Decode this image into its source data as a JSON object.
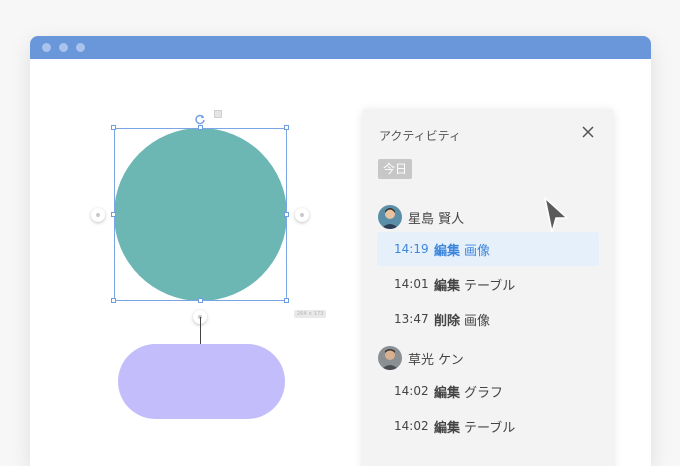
{
  "window": {
    "titlebar_color": "#6a97da"
  },
  "canvas": {
    "size_label": "264 × 173",
    "shapes": [
      {
        "kind": "circle",
        "color": "#6cb6b4",
        "selected": true
      },
      {
        "kind": "pill",
        "color": "#c3bdfb"
      }
    ]
  },
  "panel": {
    "title": "アクティビティ",
    "today_label": "今日",
    "groups": [
      {
        "user": "星島 賢人",
        "entries": [
          {
            "time": "14:19",
            "action": "編集",
            "target": "画像",
            "active": true
          },
          {
            "time": "14:01",
            "action": "編集",
            "target": "テーブル",
            "active": false
          },
          {
            "time": "13:47",
            "action": "削除",
            "target": "画像",
            "active": false
          }
        ]
      },
      {
        "user": "草光 ケン",
        "entries": [
          {
            "time": "14:02",
            "action": "編集",
            "target": "グラフ",
            "active": false
          },
          {
            "time": "14:02",
            "action": "編集",
            "target": "テーブル",
            "active": false
          }
        ]
      }
    ]
  },
  "colors": {
    "accent": "#3d86dc",
    "active_row_bg": "#e6f0fb"
  }
}
